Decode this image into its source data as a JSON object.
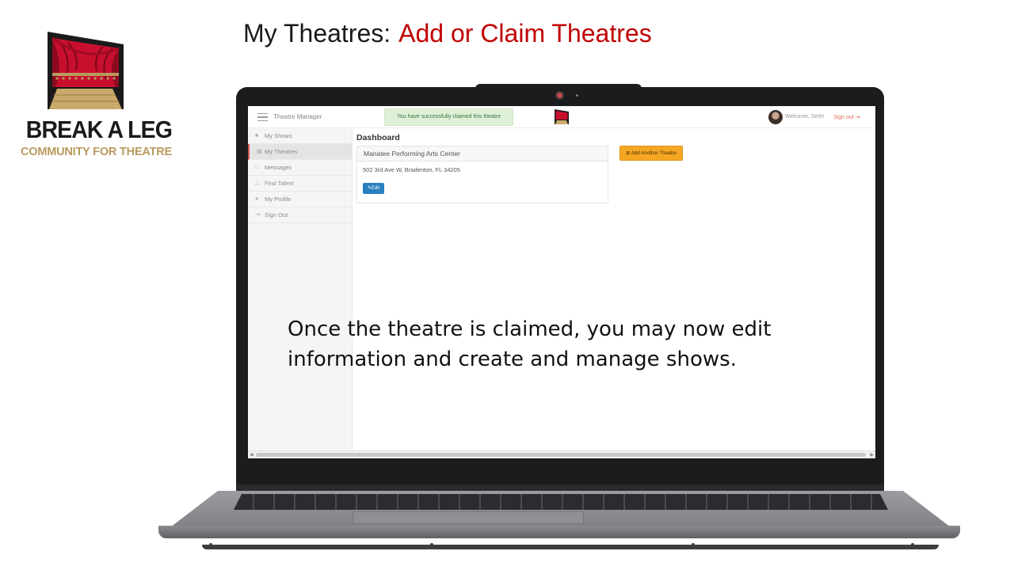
{
  "slide": {
    "title": "My Theatres:",
    "subtitle": "Add or Claim Theatres",
    "caption": "Once the theatre is claimed, you may now edit information and create and manage shows."
  },
  "logo": {
    "title": "BREAK A LEG",
    "subtitle": "COMMUNITY FOR THEATRE"
  },
  "app": {
    "brand": "Theatre Manager",
    "toast": "You have successfully claimed this theatre",
    "welcome": "Welcome, Seth!",
    "signout": "Sign out"
  },
  "sidebar": {
    "items": [
      {
        "label": "My Shows",
        "icon": "shows-icon"
      },
      {
        "label": "My Theatres",
        "icon": "theatre-icon",
        "active": true
      },
      {
        "label": "Messages",
        "icon": "messages-icon"
      },
      {
        "label": "Find Talent",
        "icon": "talent-icon"
      },
      {
        "label": "My Profile",
        "icon": "profile-icon"
      },
      {
        "label": "Sign Out",
        "icon": "signout-icon"
      }
    ]
  },
  "dashboard": {
    "title": "Dashboard",
    "theatre_name": "Manatee Performing Arts Center",
    "theatre_address": "502 3rd Ave W, Bradenton, FL 34205",
    "edit_label": "Edit",
    "add_label": "Add Another Theatre"
  },
  "colors": {
    "accent_red": "#c00000",
    "logo_gold": "#b89a5e",
    "toast_green": "#dff0d8",
    "edit_blue": "#2a7fc1",
    "add_orange": "#f5a623"
  }
}
